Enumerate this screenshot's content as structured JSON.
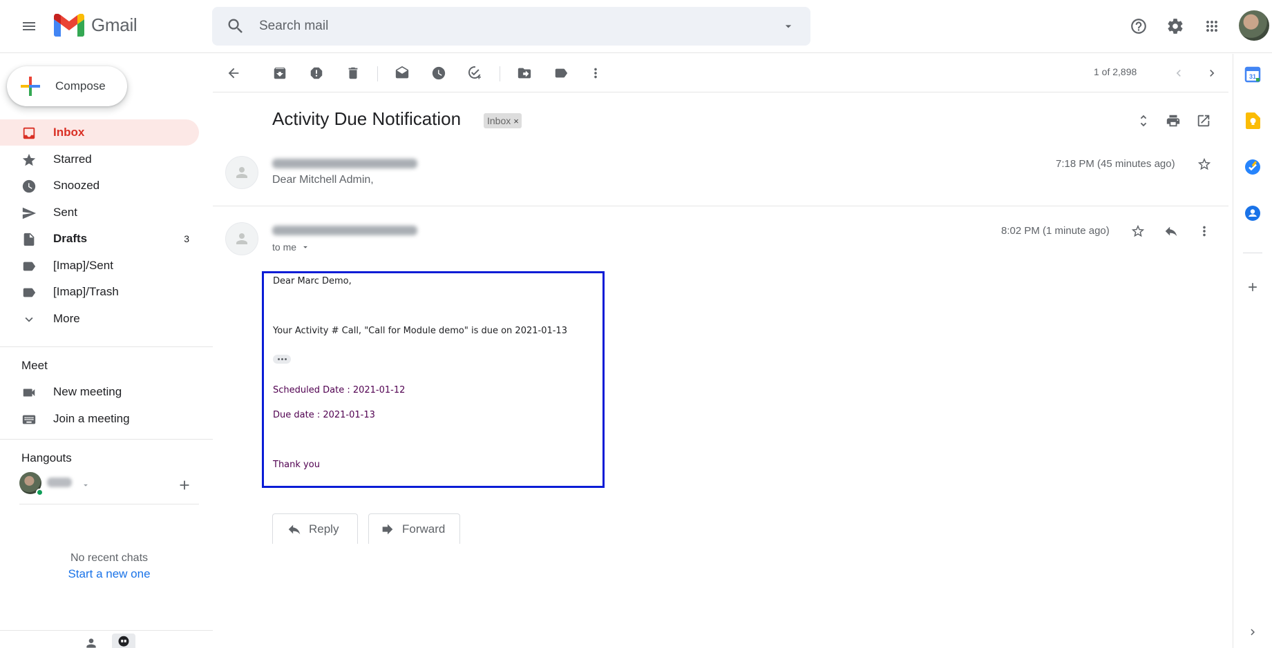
{
  "header": {
    "app_name": "Gmail",
    "search_placeholder": "Search mail",
    "icons": [
      "menu-icon",
      "help-icon",
      "settings-icon",
      "apps-icon",
      "account-avatar"
    ]
  },
  "sidebar": {
    "compose_label": "Compose",
    "items": [
      {
        "label": "Inbox",
        "icon": "inbox-icon",
        "active": true
      },
      {
        "label": "Starred",
        "icon": "star-icon"
      },
      {
        "label": "Snoozed",
        "icon": "clock-icon"
      },
      {
        "label": "Sent",
        "icon": "send-icon"
      },
      {
        "label": "Drafts",
        "icon": "draft-icon",
        "count": "3"
      },
      {
        "label": "[Imap]/Sent",
        "icon": "label-icon"
      },
      {
        "label": "[Imap]/Trash",
        "icon": "label-icon"
      },
      {
        "label": "More",
        "icon": "chevron-down-icon"
      }
    ],
    "meet": {
      "title": "Meet",
      "new_meeting": "New meeting",
      "join_meeting": "Join a meeting"
    },
    "hangouts": {
      "title": "Hangouts",
      "no_recent": "No recent chats",
      "start_new": "Start a new one"
    }
  },
  "toolbar": {
    "pager": "1 of 2,898"
  },
  "thread": {
    "subject": "Activity Due Notification",
    "label_chip": "Inbox",
    "messages": [
      {
        "snippet": "Dear Mitchell Admin,",
        "time": "7:18 PM (45 minutes ago)"
      },
      {
        "recipient": "to me",
        "time": "8:02 PM (1 minute ago)"
      }
    ],
    "body": {
      "greeting": "Dear Marc Demo,",
      "line1": "Your Activity # Call, \"Call for Module demo\" is due on 2021-01-13",
      "scheduled": "Scheduled Date : 2021-01-12",
      "due": "Due date : 2021-01-13",
      "closing": "Thank you"
    },
    "reply_label": "Reply",
    "forward_label": "Forward"
  },
  "colors": {
    "accent_red": "#d93025",
    "active_bg": "#fce8e6",
    "link_blue": "#1a73e8",
    "highlight_border": "#0a1cd6",
    "body_purple": "#500050"
  }
}
